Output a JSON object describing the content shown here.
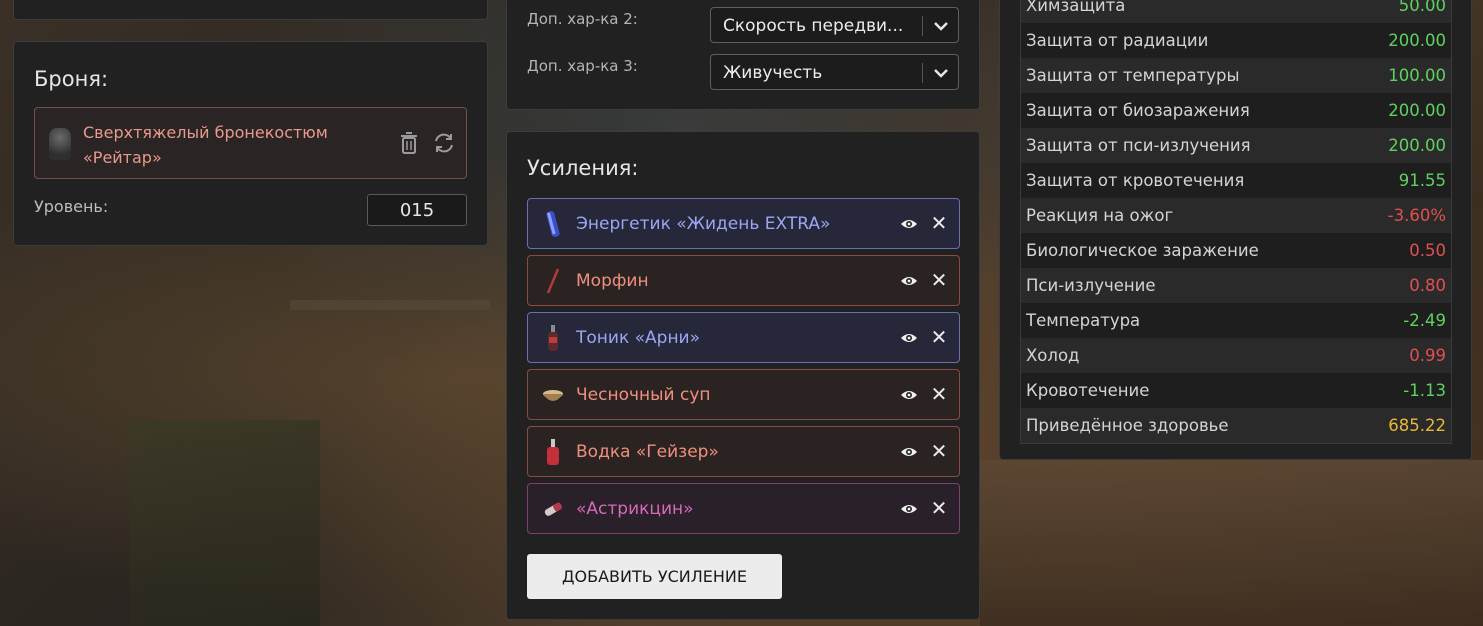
{
  "armor": {
    "title": "Броня:",
    "item_name": "Сверхтяжелый бронекостюм «Рейтар»",
    "item_color": "#e89a8c",
    "delete_icon": "trash-icon",
    "swap_icon": "refresh-icon",
    "level_label": "Уровень:",
    "level_value": "015"
  },
  "extra_stats": {
    "rows": [
      {
        "label": "Доп. хар-ка 2:",
        "value": "Скорость передви..."
      },
      {
        "label": "Доп. хар-ка 3:",
        "value": "Живучесть"
      }
    ]
  },
  "boosts": {
    "title": "Усиления:",
    "items": [
      {
        "name": "Энергетик «Жидень EXTRA»",
        "color": "#9aa7f5",
        "border": "#6a6fb0",
        "bg": "#262738",
        "icon": "energy-drink-icon"
      },
      {
        "name": "Морфин",
        "color": "#ef8f7e",
        "border": "#8a4b44",
        "bg": "#2b2322",
        "icon": "syringe-icon"
      },
      {
        "name": "Тоник «Арни»",
        "color": "#9aa7f5",
        "border": "#6a6fb0",
        "bg": "#262738",
        "icon": "tonic-bottle-icon"
      },
      {
        "name": "Чесночный суп",
        "color": "#ef8f7e",
        "border": "#8a4b44",
        "bg": "#2b2322",
        "icon": "soup-icon"
      },
      {
        "name": "Водка «Гейзер»",
        "color": "#ef8f7e",
        "border": "#8a4b44",
        "bg": "#2b2322",
        "icon": "vodka-bottle-icon"
      },
      {
        "name": "«Астрикцин»",
        "color": "#d56ab8",
        "border": "#7f3f70",
        "bg": "#2a2029",
        "icon": "injector-icon"
      }
    ],
    "add_label": "ДОБАВИТЬ УСИЛЕНИЕ"
  },
  "stats": {
    "rows": [
      {
        "name": "Химзащита",
        "value": "50.00",
        "color": "#5fd15f"
      },
      {
        "name": "Защита от радиации",
        "value": "200.00",
        "color": "#5fd15f"
      },
      {
        "name": "Защита от температуры",
        "value": "100.00",
        "color": "#5fd15f"
      },
      {
        "name": "Защита от биозаражения",
        "value": "200.00",
        "color": "#5fd15f"
      },
      {
        "name": "Защита от пси-излучения",
        "value": "200.00",
        "color": "#5fd15f"
      },
      {
        "name": "Защита от кровотечения",
        "value": "91.55",
        "color": "#5fd15f"
      },
      {
        "name": "Реакция на ожог",
        "value": "-3.60%",
        "color": "#e05050"
      },
      {
        "name": "Биологическое заражение",
        "value": "0.50",
        "color": "#e05050"
      },
      {
        "name": "Пси-излучение",
        "value": "0.80",
        "color": "#e05050"
      },
      {
        "name": "Температура",
        "value": "-2.49",
        "color": "#5fd15f"
      },
      {
        "name": "Холод",
        "value": "0.99",
        "color": "#e05050"
      },
      {
        "name": "Кровотечение",
        "value": "-1.13",
        "color": "#5fd15f"
      },
      {
        "name": "Приведённое здоровье",
        "value": "685.22",
        "color": "#e8b83a"
      }
    ]
  }
}
